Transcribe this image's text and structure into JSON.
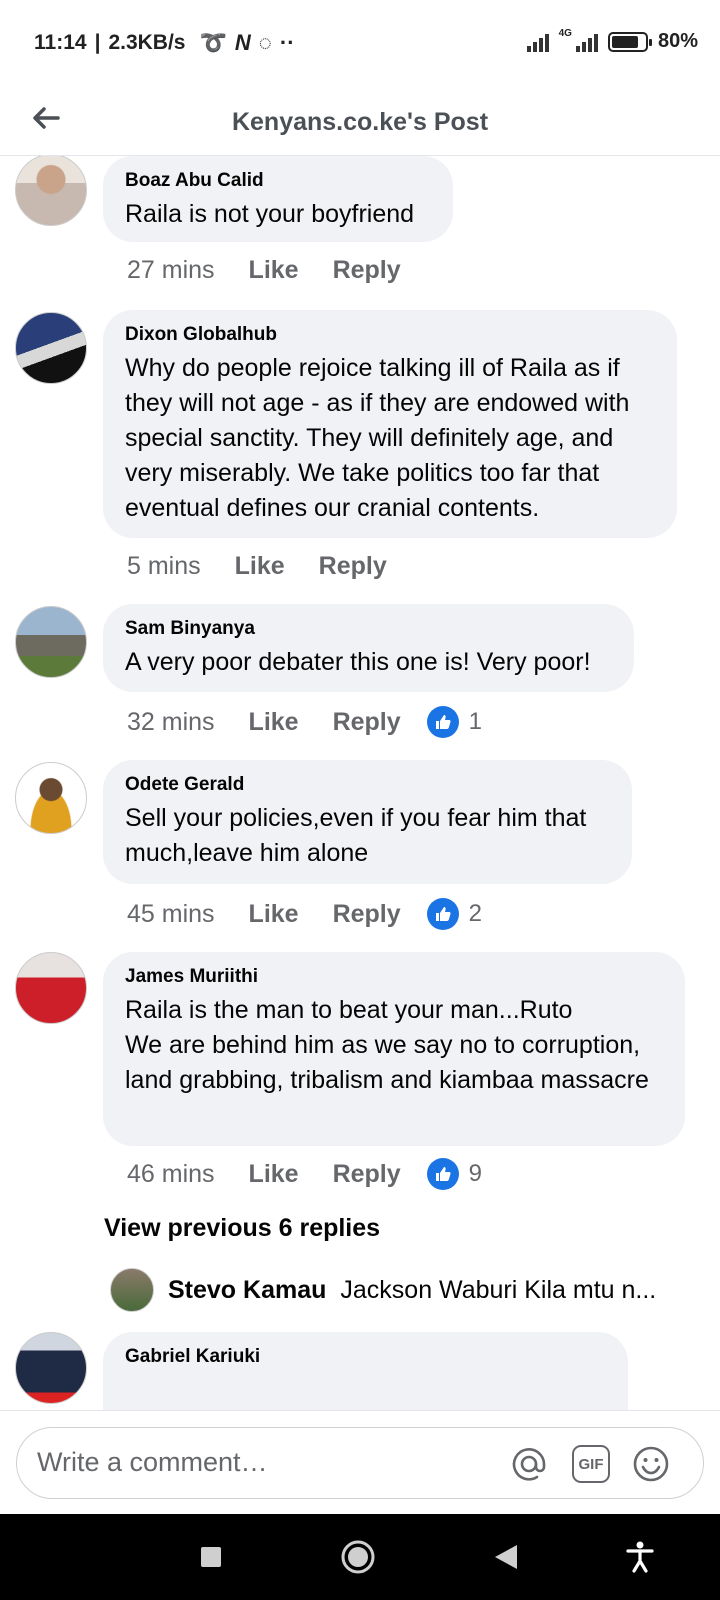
{
  "status_bar": {
    "time": "11:14",
    "speed": "2.3KB/s",
    "network": "4G",
    "battery": "80%",
    "battery_level": 0.8
  },
  "header": {
    "title": "Kenyans.co.ke's Post"
  },
  "comments": [
    {
      "name": "Boaz Abu Calid",
      "text": "Raila is not your boyfriend",
      "time": "27 mins",
      "like_label": "Like",
      "reply_label": "Reply",
      "likes": ""
    },
    {
      "name": "Dixon Globalhub",
      "text": "Why do people rejoice talking ill of Raila as if they will not age - as if they are endowed with special sanctity. They will definitely age, and very miserably. We take politics too far that eventual defines our cranial contents.",
      "time": "5 mins",
      "like_label": "Like",
      "reply_label": "Reply",
      "likes": ""
    },
    {
      "name": "Sam Binyanya",
      "text": "A very poor debater this one is! Very poor!",
      "time": "32 mins",
      "like_label": "Like",
      "reply_label": "Reply",
      "likes": "1"
    },
    {
      "name": "Odete Gerald",
      "text": "Sell your policies,even if you fear him that much,leave him alone",
      "time": "45 mins",
      "like_label": "Like",
      "reply_label": "Reply",
      "likes": "2"
    },
    {
      "name": "James Muriithi",
      "text": "Raila is the man to beat your man...Ruto\nWe are behind him as we say no to corruption, land grabbing, tribalism and kiambaa massacre",
      "time": "46 mins",
      "like_label": "Like",
      "reply_label": "Reply",
      "likes": "9"
    },
    {
      "name": "Gabriel Kariuki",
      "text": ""
    }
  ],
  "view_previous": "View previous 6 replies",
  "reply_preview": {
    "name": "Stevo Kamau",
    "text": "Jackson Waburi Kila mtu n..."
  },
  "composer": {
    "placeholder": "Write a comment…",
    "mention_icon": "at-icon",
    "gif_label": "GIF",
    "emoji_icon": "emoji-icon"
  },
  "colors": {
    "bubble": "#f0f2f5",
    "like_blue": "#1b74e4",
    "secondary_text": "#65676b"
  }
}
